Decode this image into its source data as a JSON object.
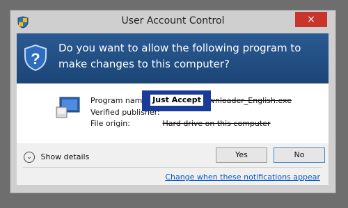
{
  "window": {
    "title": "User Account Control",
    "close_label": "×"
  },
  "header": {
    "question": "Do you want to allow the following program to make changes to this computer?"
  },
  "details": {
    "program_name_label": "Program name:",
    "program_name_value": "installer_idownloader_English.exe",
    "publisher_label": "Verified publisher:",
    "publisher_value": "",
    "origin_label": "File origin:",
    "origin_value": "Hard drive on this computer"
  },
  "overlay": {
    "label": "Just Accept"
  },
  "footer": {
    "show_details": "Show details",
    "yes": "Yes",
    "no": "No",
    "change_link": "Change when these notifications appear"
  },
  "icons": [
    "uac-shield-icon",
    "program-icon",
    "chevron-down-icon"
  ],
  "colors": {
    "header_blue": "#1f4f86",
    "overlay_blue": "#193d96",
    "close_red": "#c7352b",
    "link_blue": "#0a58c2"
  }
}
